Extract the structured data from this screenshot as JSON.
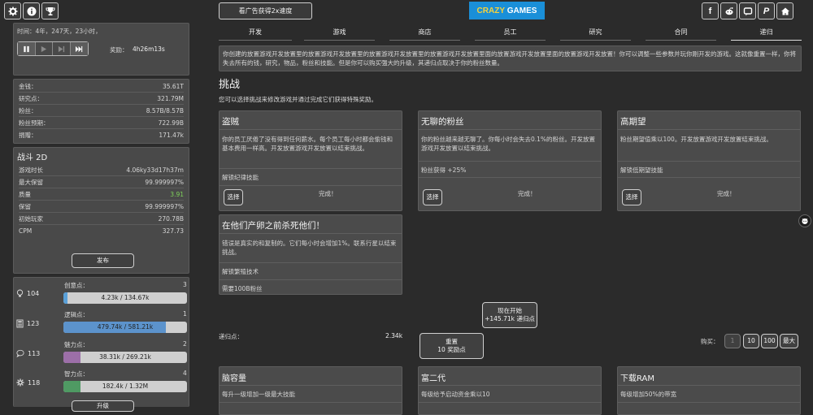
{
  "top": {
    "ad_button": "看广告获得2x速度",
    "logo_a": "CRAZY",
    "logo_b": "GAMES",
    "social_icons": [
      "facebook-icon",
      "reddit-icon",
      "discord-icon",
      "paypal-icon",
      "home-icon"
    ],
    "left_icons": [
      "gear-icon",
      "info-icon",
      "trophy-icon"
    ]
  },
  "time": {
    "label": "时间：4年，247天，23小时，",
    "reward_label": "奖励：",
    "reward_value": "4h26m13s"
  },
  "stats": [
    {
      "label": "金钱：",
      "value": "35.61T"
    },
    {
      "label": "研究点：",
      "value": "321.79M"
    },
    {
      "label": "粉丝：",
      "value": "8.57B/8.57B"
    },
    {
      "label": "粉丝预期：",
      "value": "722.99B"
    },
    {
      "label": "捐赠：",
      "value": "171.47k"
    }
  ],
  "game": {
    "title": "战斗 2D",
    "rows": [
      {
        "label": "游戏时长",
        "value": "4.06ky33d17h37m"
      },
      {
        "label": "最大保留",
        "value": "99.999997%"
      },
      {
        "label": "质量",
        "value": "3.91"
      },
      {
        "label": "保留",
        "value": "99.999997%"
      },
      {
        "label": "初始玩家",
        "value": "270.78B"
      },
      {
        "label": "CPM",
        "value": "327.73"
      }
    ],
    "quality_color": "#7fd35a",
    "publish_button": "发布"
  },
  "skills": [
    {
      "icon": "lightbulb-icon",
      "num": "104",
      "name": "创意点：",
      "level": "3",
      "bar": "4.23k / 134.67k",
      "fraction": 0.03,
      "color": "#5aa0d8"
    },
    {
      "icon": "calculator-icon",
      "num": "123",
      "name": "逻辑点：",
      "level": "1",
      "bar": "479.74k / 581.21k",
      "fraction": 0.83,
      "color": "#5c93cc"
    },
    {
      "icon": "chat-icon",
      "num": "113",
      "name": "魅力点：",
      "level": "2",
      "bar": "38.31k / 269.21k",
      "fraction": 0.14,
      "color": "#9c6fa8"
    },
    {
      "icon": "cog-icon",
      "num": "118",
      "name": "智力点：",
      "level": "4",
      "bar": "182.4k / 1.32M",
      "fraction": 0.14,
      "color": "#4f9a63"
    }
  ],
  "upgrade_button": "升级",
  "tabs": [
    "开发",
    "游戏",
    "商店",
    "员工",
    "研究",
    "合同",
    "递归"
  ],
  "intro": "你创建的放置游戏开发放置里的放置游戏开发放置里的放置游戏开发放置里的放置游戏开发放置里面的放置游戏开发放置里面的放置游戏开发放置！你可以调整一些参数并玩你刚开发的游戏。这就像重置一样，你将失去所有的钱，研究，物品，粉丝和技能。但是你可以购买强大的升级，其递归点取决于你的粉丝数量。",
  "challenges": {
    "title": "挑战",
    "subtitle": "您可以选择挑战来修改游戏并通过完成它们获得特殊奖励。",
    "cards": [
      {
        "title": "盗贼",
        "desc": "你的员工厌倦了没有得到任何薪水。每个员工每小时都会偷钱和基本费用一样高。开发放置游戏开发放置以结束挑战。",
        "reward": "解锁纪律技能",
        "select": "选择",
        "status": "完成！"
      },
      {
        "title": "无聊的粉丝",
        "desc": "你的粉丝越来越无聊了。你每小时会失去0.1%的粉丝。开发放置游戏开发放置以结束挑战。",
        "reward": "粉丝获得 +25%",
        "select": "选择",
        "status": "完成！"
      },
      {
        "title": "高期望",
        "desc": "粉丝期望值乘以100。开发放置游戏开发放置结束挑战。",
        "reward": "解锁低期望技能",
        "select": "选择",
        "status": "完成！"
      },
      {
        "title": "在他们产卵之前杀死他们！",
        "desc": "错误是真实的和复制的。它们每小时会增加1%。联系行星以结束挑战。",
        "reward": "解锁繁殖技术",
        "requirement": "需要100B粉丝"
      }
    ]
  },
  "start_button": {
    "line1": "现在开始",
    "line2": "+145.71k 递归点"
  },
  "recursion": {
    "label": "递归点：",
    "value": "2.34k"
  },
  "reset_button": {
    "line1": "重置",
    "line2": "10 奖励点"
  },
  "buy": {
    "label": "购买：",
    "options": [
      "1",
      "10",
      "100",
      "最大"
    ]
  },
  "upgrades": [
    {
      "title": "脑容量",
      "desc": "每升一级增加一级最大技能"
    },
    {
      "title": "富二代",
      "desc": "每级给予启动资金乘以10"
    },
    {
      "title": "下载RAM",
      "desc": "每级增加50%的带宽"
    }
  ]
}
